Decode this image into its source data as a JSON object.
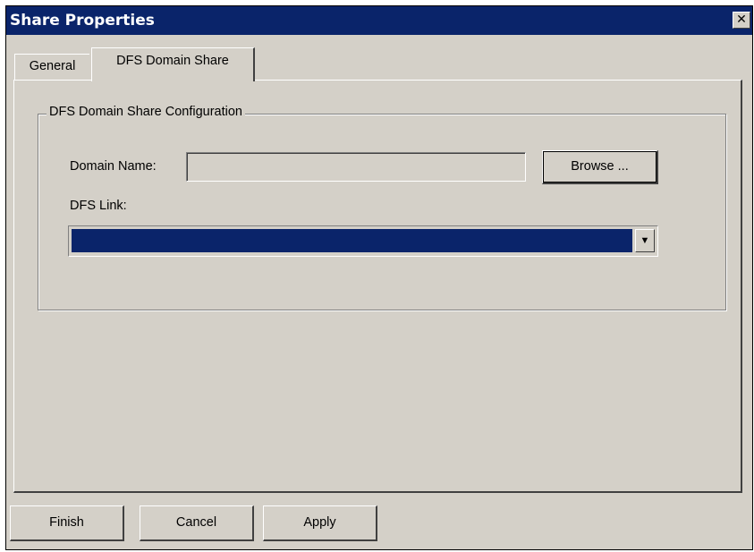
{
  "window": {
    "title": "Share Properties",
    "close_glyph": "✕"
  },
  "tabs": [
    {
      "label": "General",
      "active": false
    },
    {
      "label": "DFS Domain Share",
      "active": true
    }
  ],
  "group": {
    "legend": "DFS Domain Share Configuration",
    "domain_name_label": "Domain Name:",
    "domain_name_value": "",
    "browse_label": "Browse ...",
    "dfs_link_label": "DFS Link:",
    "dfs_link_value": "",
    "dropdown_glyph": "▼"
  },
  "footer": {
    "finish_label": "Finish",
    "cancel_label": "Cancel",
    "apply_label": "Apply"
  },
  "colors": {
    "titlebar": "#0a246a",
    "face": "#d4d0c8",
    "selection": "#0a246a"
  }
}
